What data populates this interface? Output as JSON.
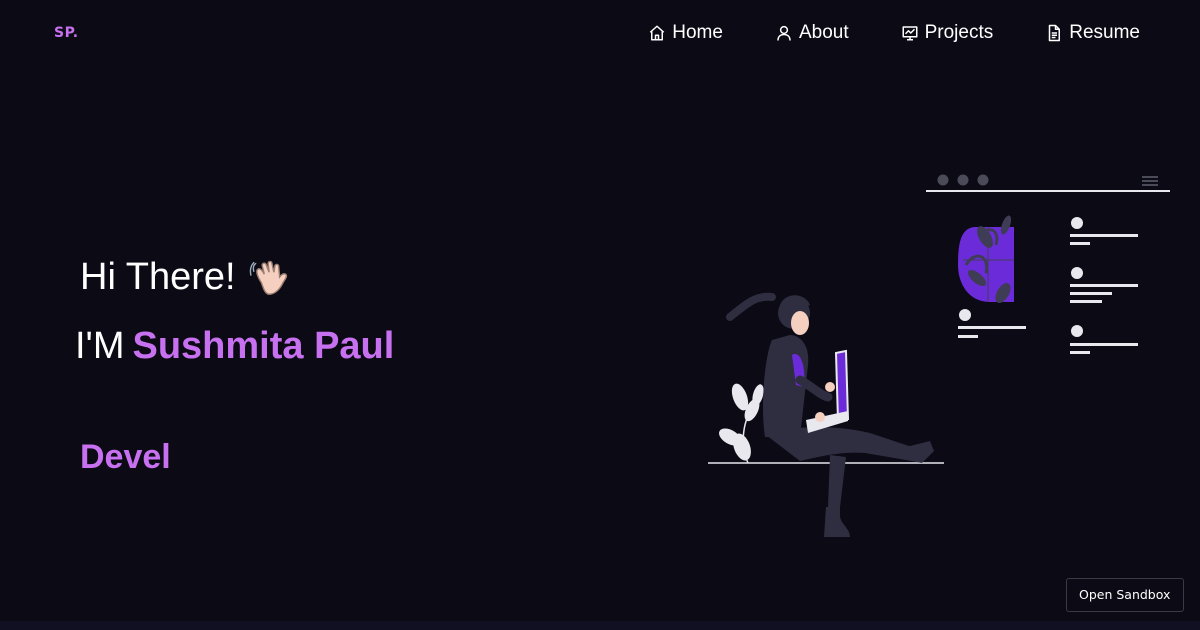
{
  "logo": "SP.",
  "nav": {
    "items": [
      {
        "label": "Home",
        "icon": "home-icon"
      },
      {
        "label": "About",
        "icon": "user-icon"
      },
      {
        "label": "Projects",
        "icon": "presentation-chart-icon"
      },
      {
        "label": "Resume",
        "icon": "document-icon"
      }
    ]
  },
  "hero": {
    "greeting": "Hi There!",
    "wave_icon": "waving-hand-icon",
    "intro_prefix": "I'M",
    "name": "Sushmita Paul",
    "typewriter_text": "Devel"
  },
  "sandbox": {
    "label": "Open Sandbox"
  },
  "colors": {
    "background": "#0c0a15",
    "accent": "#c770f0",
    "illustration_purple": "#6c2bd9",
    "text": "#ffffff"
  }
}
